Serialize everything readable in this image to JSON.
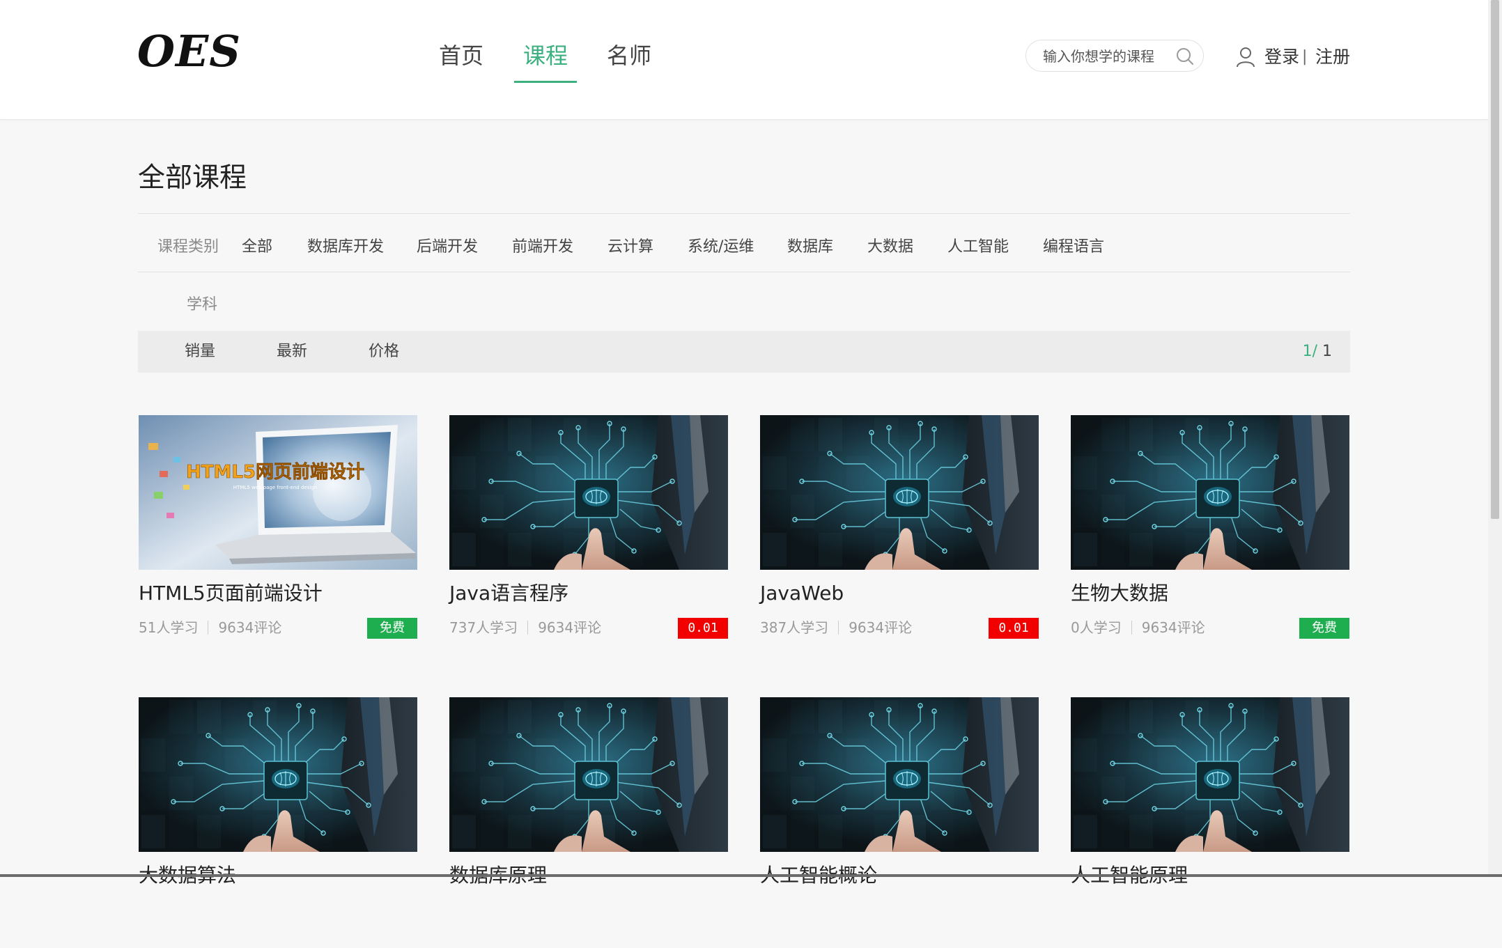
{
  "header": {
    "logo": "OES",
    "nav": [
      {
        "label": "首页",
        "active": false
      },
      {
        "label": "课程",
        "active": true
      },
      {
        "label": "名师",
        "active": false
      }
    ],
    "search_placeholder": "输入你想学的课程",
    "login_label": "登录",
    "separator": "|",
    "register_label": "注册"
  },
  "page_title": "全部课程",
  "filters": {
    "category_label": "课程类别",
    "categories": [
      "全部",
      "数据库开发",
      "后端开发",
      "前端开发",
      "云计算",
      "系统/运维",
      "数据库",
      "大数据",
      "人工智能",
      "编程语言"
    ],
    "subject_label": "学科"
  },
  "sort": {
    "options": [
      "销量",
      "最新",
      "价格"
    ],
    "page_current": "1/",
    "page_total": "1"
  },
  "courses": [
    {
      "title": "HTML5页面前端设计",
      "learners": "51人学习",
      "comments": "9634评论",
      "price": "免费",
      "free": true,
      "image": "laptop-html5-banner",
      "banner_text": "HTML5网页前端设计",
      "banner_sub": "HTML5 web page front-end design"
    },
    {
      "title": "Java语言程序",
      "learners": "737人学习",
      "comments": "9634评论",
      "price": "0.01",
      "free": false,
      "image": "ai-brain-chip"
    },
    {
      "title": "JavaWeb",
      "learners": "387人学习",
      "comments": "9634评论",
      "price": "0.01",
      "free": false,
      "image": "ai-brain-chip"
    },
    {
      "title": "生物大数据",
      "learners": "0人学习",
      "comments": "9634评论",
      "price": "免费",
      "free": true,
      "image": "ai-brain-chip"
    },
    {
      "title": "大数据算法",
      "image": "ai-brain-chip"
    },
    {
      "title": "数据库原理",
      "image": "ai-brain-chip"
    },
    {
      "title": "人工智能概论",
      "image": "ai-brain-chip"
    },
    {
      "title": "人工智能原理",
      "image": "ai-brain-chip"
    }
  ],
  "colors": {
    "accent": "#3cb07e",
    "free_badge": "#1fae4f",
    "paid_badge": "#f20000"
  }
}
